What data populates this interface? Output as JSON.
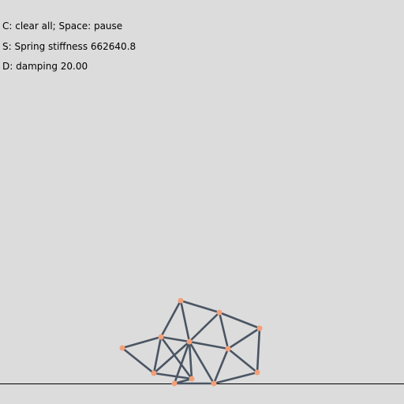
{
  "controls": {
    "clear_pause": "C: clear all; Space: pause",
    "spring": "S: Spring stiffness 662640.8",
    "damping": "D: damping 20.00"
  },
  "colors": {
    "background": "#dcdcdc",
    "spring": "#4a5563",
    "mass": "#f2a07a",
    "ground": "#000000"
  }
}
